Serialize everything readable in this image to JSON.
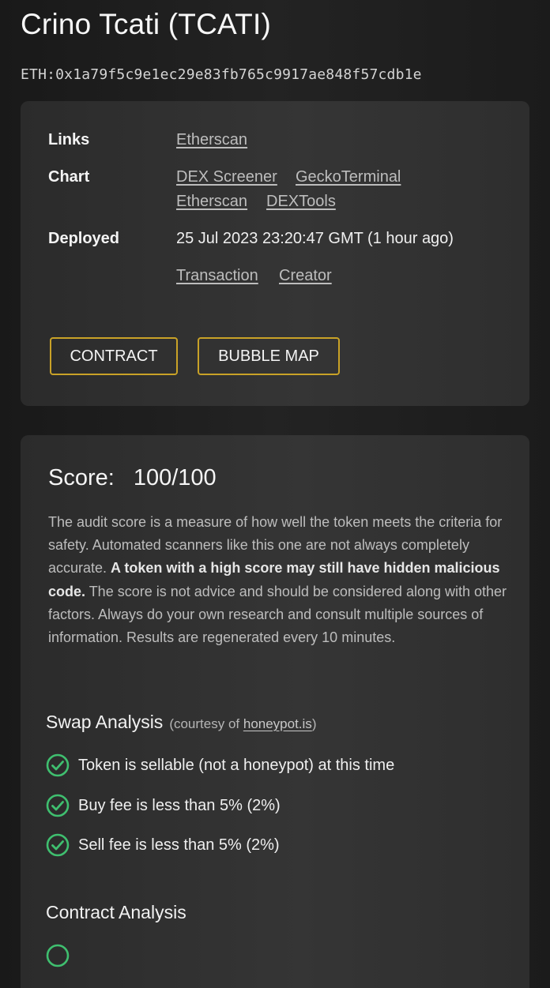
{
  "header": {
    "title": "Crino Tcati (TCATI)",
    "address": "ETH:0x1a79f5c9e1ec29e83fb765c9917ae848f57cdb1e"
  },
  "info": {
    "links_label": "Links",
    "links": [
      "Etherscan"
    ],
    "chart_label": "Chart",
    "chart_links": [
      "DEX Screener",
      "GeckoTerminal",
      "Etherscan",
      "DEXTools"
    ],
    "deployed_label": "Deployed",
    "deployed_value": "25 Jul 2023 23:20:47 GMT (1 hour ago)",
    "deployed_links": [
      "Transaction",
      "Creator"
    ],
    "contract_button": "CONTRACT",
    "bubble_map_button": "BUBBLE MAP"
  },
  "score": {
    "label": "Score:",
    "value": "100/100",
    "description_part1": "The audit score is a measure of how well the token meets the criteria for safety.  Automated scanners like this one are not always completely accurate. ",
    "description_bold": "A token with a high score may still have hidden malicious code.",
    "description_part2": " The score is not advice and should be considered along with other factors. Always do your own research and consult multiple sources of information.  Results are regenerated every 10 minutes."
  },
  "swap_analysis": {
    "title": "Swap Analysis",
    "courtesy_prefix": "(courtesy of ",
    "courtesy_link": "honeypot.is",
    "courtesy_suffix": ")",
    "items": [
      {
        "text": "Token is sellable (not a honeypot) at this time",
        "icon": "check-circle-icon"
      },
      {
        "text": "Buy fee is less than 5% (2%)",
        "icon": "check-circle-icon"
      },
      {
        "text": "Sell fee is less than 5% (2%)",
        "icon": "check-circle-icon"
      }
    ]
  },
  "contract_analysis": {
    "title": "Contract Analysis"
  },
  "colors": {
    "accent_button_border": "#c9a227",
    "check_green": "#3fbf6f"
  }
}
